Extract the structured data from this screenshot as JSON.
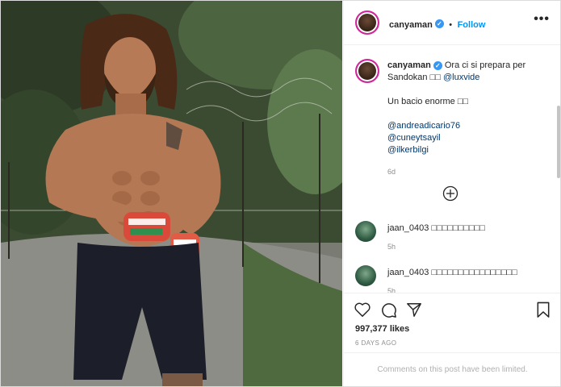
{
  "post": {
    "author": "canyaman",
    "follow_label": "Follow",
    "separator": "•",
    "more_label": "•••",
    "verified_icon": "verified-badge-icon"
  },
  "caption": {
    "username": "canyaman",
    "text_line1": "Ora ci si prepara per",
    "text_line2_prefix": "Sandokan",
    "text_line2_emoji": "□□",
    "mention_main": "@luxvide",
    "line2": "Un bacio enorme",
    "line2_emoji": "□□",
    "mentions": [
      "@andreadicario76",
      "@cuneytsayil",
      "@ilkerbilgi"
    ],
    "time": "6d"
  },
  "comments": [
    {
      "username": "jaan_0403",
      "text": "□□□□□□□□□□",
      "time": "5h"
    },
    {
      "username": "jaan_0403",
      "text": "□□□□□□□□□□□□□□□□",
      "time": "5h"
    }
  ],
  "load_more_icon": "plus-circle-icon",
  "actions": {
    "likes": "997,377 likes",
    "date": "6 DAYS AGO",
    "icons": [
      "heart-icon",
      "comment-icon",
      "share-icon",
      "bookmark-icon"
    ]
  },
  "footer": {
    "limited_text": "Comments on this post have been limited."
  },
  "colors": {
    "accent": "#0095f6",
    "link": "#00376b",
    "muted": "#8e8e8e"
  }
}
